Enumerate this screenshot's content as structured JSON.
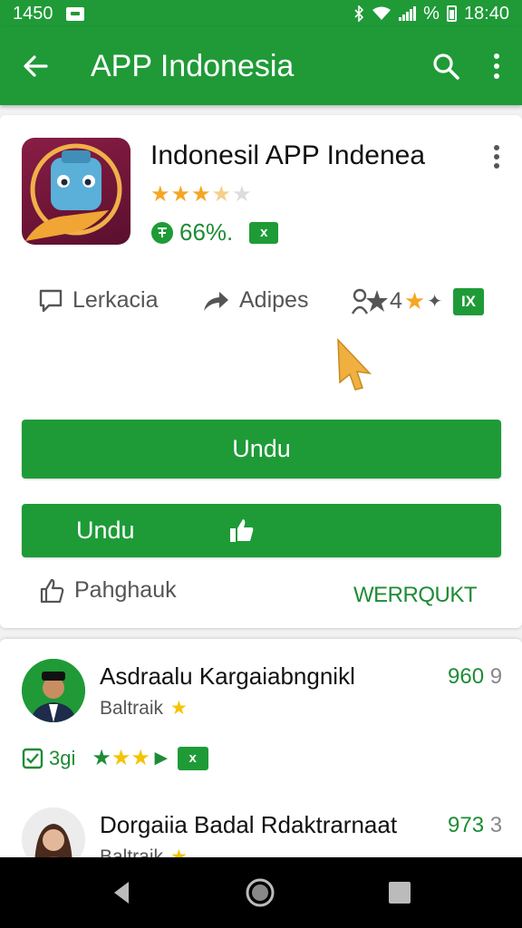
{
  "status_bar": {
    "left_time": "1450",
    "battery_percent_label": "%",
    "right_time": "18:40"
  },
  "app_bar": {
    "title": "APP Indonesia",
    "icons": [
      "back-arrow-icon",
      "search-icon",
      "more-vert-icon"
    ]
  },
  "app_card": {
    "title": "Indonesil APP Indenea",
    "rating_stars": 3.5,
    "rating_percent": "66%.",
    "badge": "x",
    "actions": [
      {
        "label": "Lerkacia",
        "icon": "comment-icon"
      },
      {
        "label": "Adipes",
        "icon": "share-icon"
      },
      {
        "label": "4",
        "icon": "rating-people-icon"
      }
    ],
    "action_badge": "IX",
    "install_button": "Undu",
    "like_button": "Undu",
    "feedback_label": "Pahghauk",
    "more_link": "WERRQUKT"
  },
  "reviews": [
    {
      "name": "Asdraalu Kargaiabngnikl",
      "sub_label": "Baltraik",
      "score_main": "960",
      "score_suffix": "9",
      "meta_count": "3gi",
      "meta_badge": "x"
    },
    {
      "name": "Dorgaiia Badal Rdaktrarnaat",
      "sub_label": "Baltraik",
      "score_main": "973",
      "score_suffix": "3"
    }
  ],
  "colors": {
    "primary": "#1f9a37",
    "accent_text": "#1e8c35",
    "star": "#f5a623",
    "navbar": "#000000"
  }
}
